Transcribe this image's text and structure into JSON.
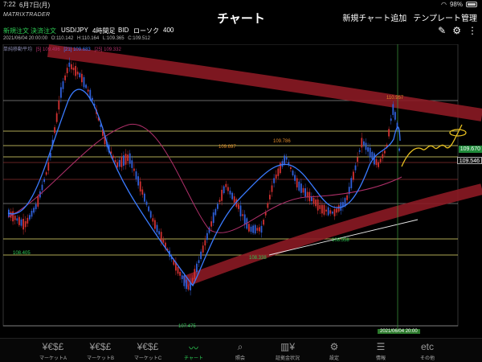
{
  "status": {
    "time": "7:22",
    "date": "6月7日(月)",
    "battery": "98%"
  },
  "header": {
    "logo": "MATRIXTRADER",
    "title": "チャート",
    "add_chart": "新規チャート追加",
    "template": "テンプレート管理"
  },
  "toolbar": {
    "new_order": "新規注文",
    "settle_order": "決済注文",
    "pair": "USD/JPY",
    "interval": "4時間足",
    "side": "BID",
    "chart_type": "ローソク",
    "count": "400"
  },
  "ohlc": {
    "datetime": "2021/06/04 20:00:00",
    "open": "O:110.142",
    "high": "H:110.164",
    "low": "L:109.365",
    "close": "C:109.512"
  },
  "ma": {
    "name": "単純移動平均",
    "v1": "[5] 109.496",
    "v2": "[21] 109.683",
    "v3": "[25] 109.332"
  },
  "chart_labels": {
    "high_left": "110.957",
    "mid1": "109.697",
    "mid2": "109.786",
    "low_left": "108.405",
    "low_mid": "108.338",
    "low_right": "108.558",
    "bottom": "107.475",
    "price_current": "109.670",
    "price_close": "109.546",
    "date_cursor": "2021/06/04 20:00"
  },
  "nav": {
    "items": [
      {
        "label": "マーケットA",
        "icon": "¥€$£"
      },
      {
        "label": "マーケットB",
        "icon": "¥€$£"
      },
      {
        "label": "マーケットC",
        "icon": "¥€$£"
      },
      {
        "label": "チャート",
        "icon": "chart-icon"
      },
      {
        "label": "照会",
        "icon": "search-icon"
      },
      {
        "label": "証拠金状況",
        "icon": "yen-bars-icon"
      },
      {
        "label": "設定",
        "icon": "gear-icon"
      },
      {
        "label": "情報",
        "icon": "news-icon"
      },
      {
        "label": "その他",
        "icon": "etc"
      }
    ]
  }
}
